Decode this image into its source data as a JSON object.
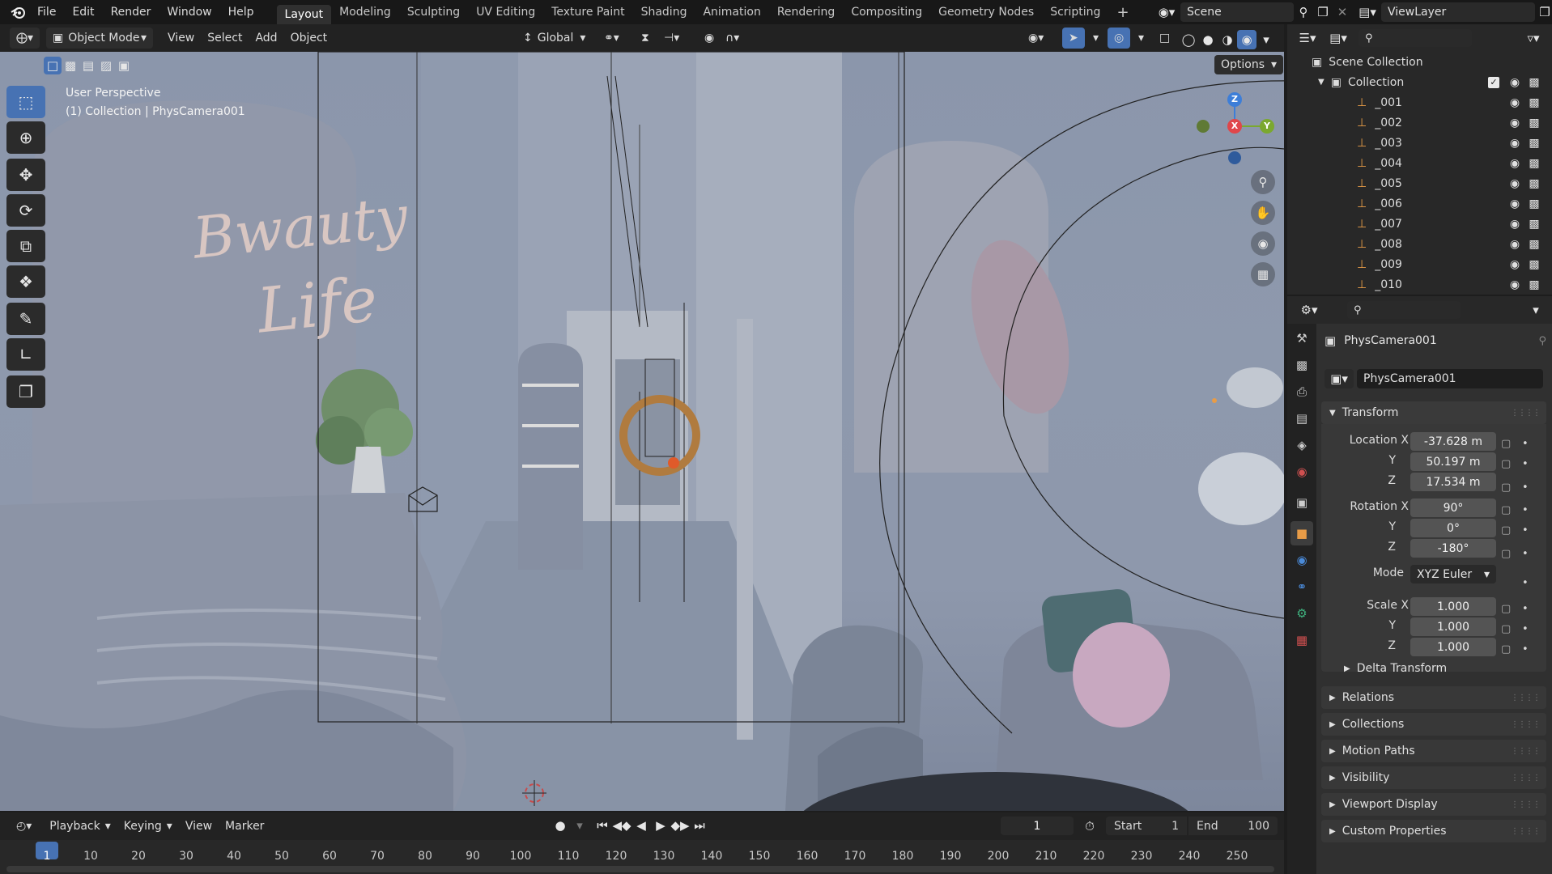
{
  "topbar": {
    "menus": [
      "File",
      "Edit",
      "Render",
      "Window",
      "Help"
    ],
    "workspaces": [
      "Layout",
      "Modeling",
      "Sculpting",
      "UV Editing",
      "Texture Paint",
      "Shading",
      "Animation",
      "Rendering",
      "Compositing",
      "Geometry Nodes",
      "Scripting"
    ],
    "active_workspace": "Layout",
    "add_tab": "+",
    "scene": "Scene",
    "view_layer": "ViewLayer"
  },
  "viewport_header": {
    "mode": "Object Mode",
    "menus": [
      "View",
      "Select",
      "Add",
      "Object"
    ],
    "orientation": "Global",
    "options_label": "Options"
  },
  "viewport": {
    "perspective_label": "User Perspective",
    "context_label": "(1) Collection | PhysCamera001",
    "gizmo_axes": {
      "z": "Z",
      "x": "X",
      "y": "Y"
    },
    "sign_text_line1": "Bwauty",
    "sign_text_line2": "Life"
  },
  "outliner": {
    "root": "Scene Collection",
    "collection": "Collection",
    "items": [
      "_001",
      "_002",
      "_003",
      "_004",
      "_005",
      "_006",
      "_007",
      "_008",
      "_009",
      "_010"
    ]
  },
  "properties": {
    "object_name": "PhysCamera001",
    "datablock_name": "PhysCamera001",
    "transform_label": "Transform",
    "location_label": "Location X",
    "rotation_label": "Rotation X",
    "scale_label": "Scale X",
    "y_label": "Y",
    "z_label": "Z",
    "location": {
      "x": "-37.628 m",
      "y": "50.197 m",
      "z": "17.534 m"
    },
    "rotation": {
      "x": "90°",
      "y": "0°",
      "z": "-180°"
    },
    "mode_label": "Mode",
    "mode_value": "XYZ Euler",
    "scale": {
      "x": "1.000",
      "y": "1.000",
      "z": "1.000"
    },
    "delta_transform": "Delta Transform",
    "sections": [
      "Relations",
      "Collections",
      "Motion Paths",
      "Visibility",
      "Viewport Display",
      "Custom Properties"
    ]
  },
  "timeline": {
    "menus": [
      "Playback",
      "Keying",
      "View",
      "Marker"
    ],
    "current_frame": "1",
    "start_label": "Start",
    "start_value": "1",
    "end_label": "End",
    "end_value": "100",
    "ticks": [
      "1",
      "10",
      "20",
      "30",
      "40",
      "50",
      "60",
      "70",
      "80",
      "90",
      "100",
      "110",
      "120",
      "130",
      "140",
      "150",
      "160",
      "170",
      "180",
      "190",
      "200",
      "210",
      "220",
      "230",
      "240",
      "250"
    ]
  },
  "colors": {
    "accent": "#4772b3",
    "axis_x": "#e0464a",
    "axis_y": "#7ba82f",
    "axis_z": "#3d7ed8",
    "object_orange": "#e89c47"
  }
}
